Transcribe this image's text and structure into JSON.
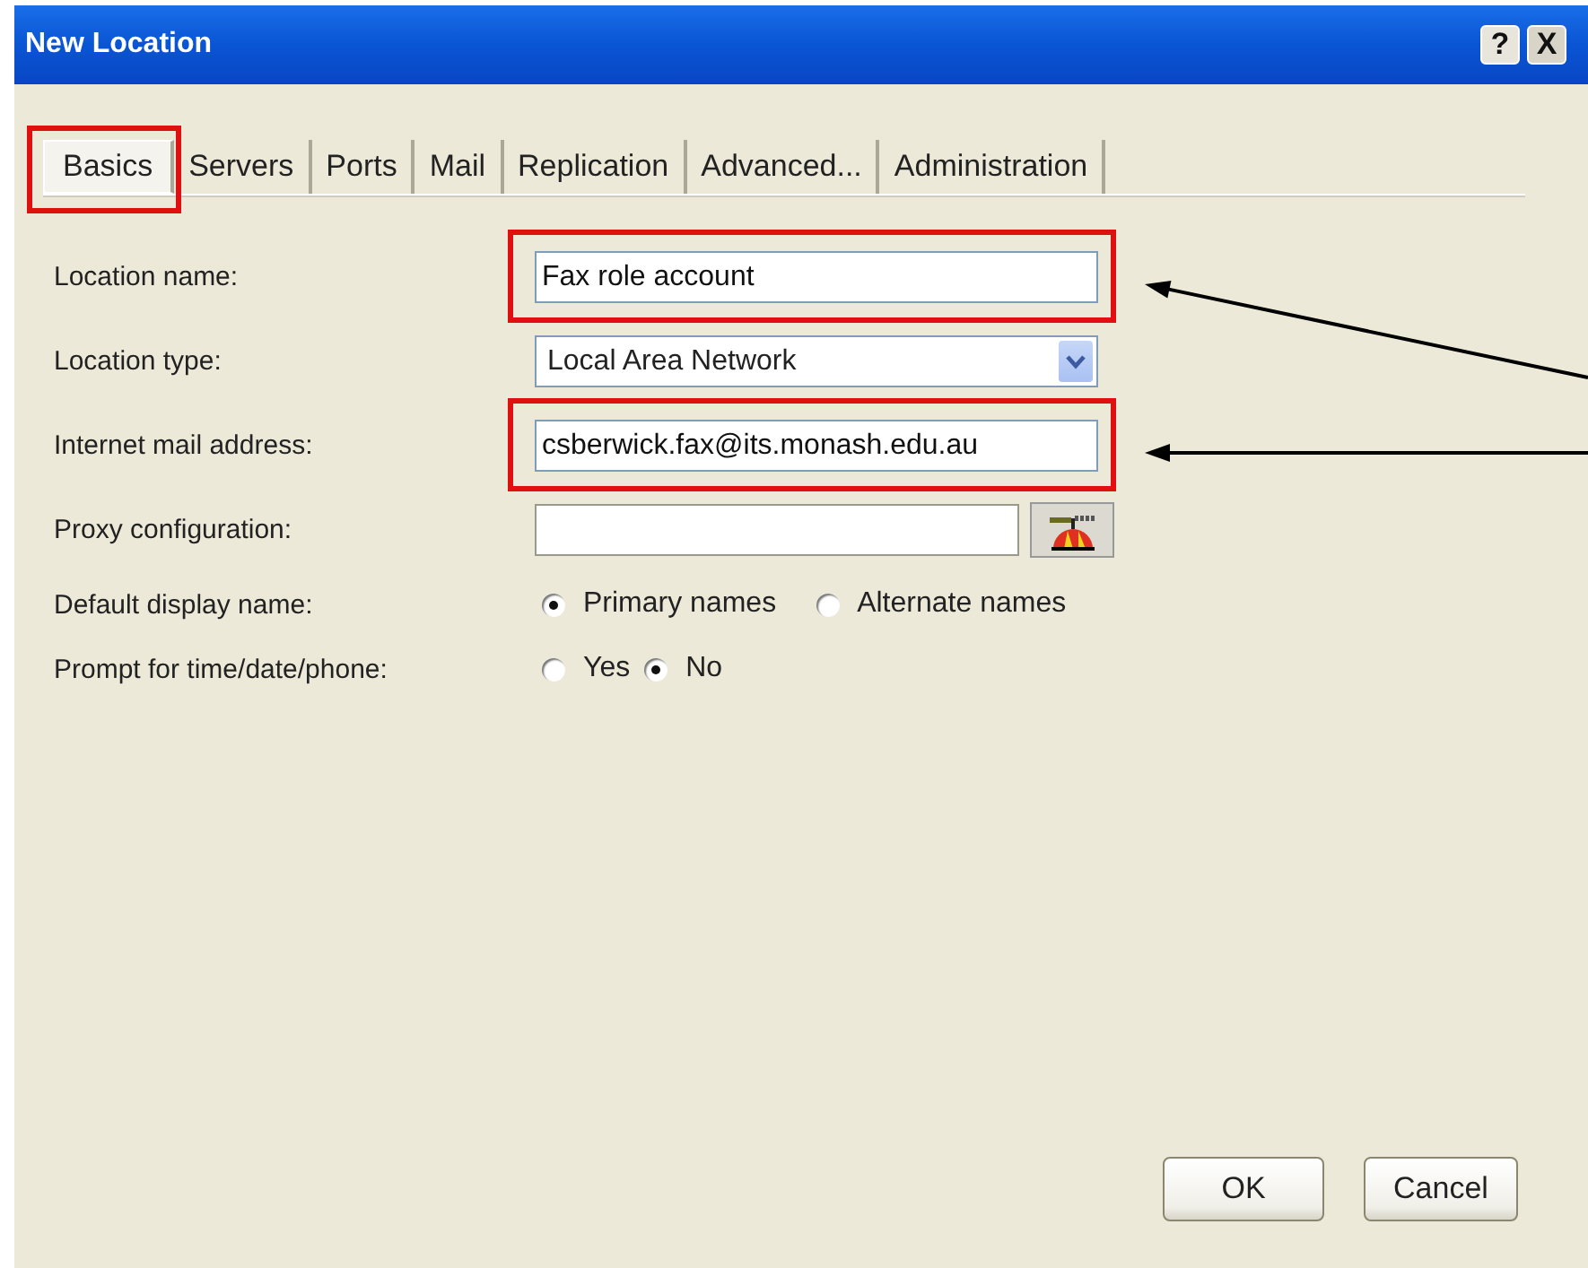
{
  "window": {
    "title": "New Location",
    "controls": [
      "?",
      "X"
    ]
  },
  "tabs": [
    {
      "label": "Basics",
      "selected": true,
      "highlighted": true
    },
    {
      "label": "Servers",
      "selected": false,
      "highlighted": false
    },
    {
      "label": "Ports",
      "selected": false,
      "highlighted": false
    },
    {
      "label": "Mail",
      "selected": false,
      "highlighted": false
    },
    {
      "label": "Replication",
      "selected": false,
      "highlighted": false
    },
    {
      "label": "Advanced...",
      "selected": false,
      "highlighted": false
    },
    {
      "label": "Administration",
      "selected": false,
      "highlighted": false
    }
  ],
  "fields": [
    {
      "kind": "text",
      "label": "Location name:",
      "value": "Fax role account",
      "highlighted": true,
      "arrow": true
    },
    {
      "kind": "dropdown",
      "label": "Location type:",
      "value": "Local Area Network",
      "highlighted": false,
      "arrow": false
    },
    {
      "kind": "text",
      "label": "Internet mail address:",
      "value": "csberwick.fax@its.monash.edu.au",
      "highlighted": true,
      "arrow": true
    },
    {
      "kind": "text-button",
      "label": "Proxy configuration:",
      "highlighted": false,
      "arrow": false
    },
    {
      "kind": "radio",
      "label": "Default display name:",
      "options": [
        {
          "label": "Primary names",
          "selected": true
        },
        {
          "label": "Alternate names",
          "selected": false
        }
      ]
    },
    {
      "kind": "radio",
      "label": "Prompt for time/date/phone:",
      "options": [
        {
          "label": "Yes",
          "selected": false
        },
        {
          "label": "No",
          "selected": true
        }
      ]
    }
  ],
  "buttons": [
    "OK",
    "Cancel"
  ]
}
